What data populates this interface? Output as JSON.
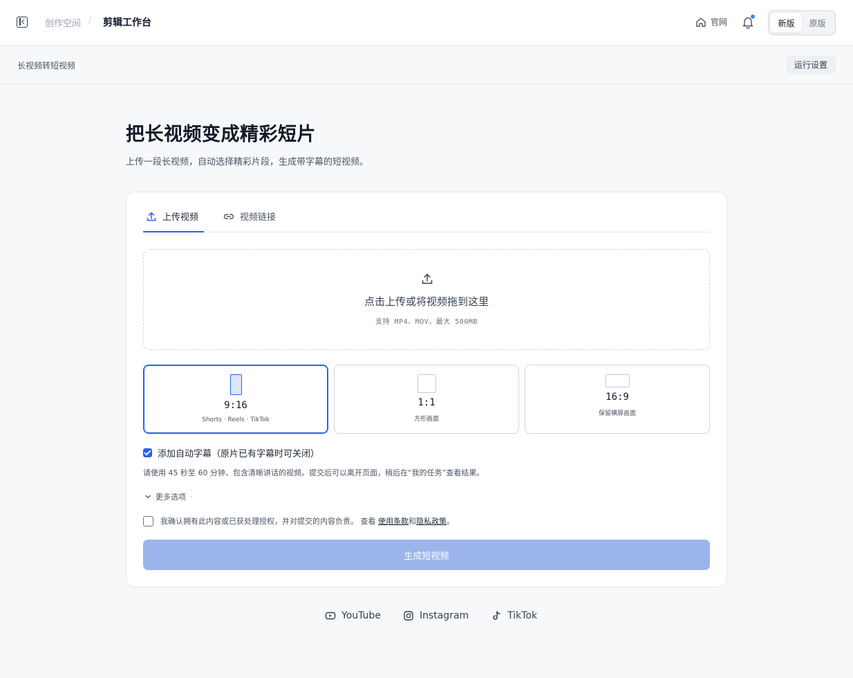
{
  "header": {
    "breadcrumb_root": "创作空间",
    "breadcrumb_sep": "/",
    "breadcrumb_current": "剪辑工作台",
    "home_label": "官网",
    "version_new": "新版",
    "version_old": "原版"
  },
  "subbar": {
    "title": "长视频转短视频",
    "run_settings": "运行设置"
  },
  "hero": {
    "title": "把长视频变成精彩短片",
    "subtitle": "上传一段长视频，自动选择精彩片段，生成带字幕的短视频。"
  },
  "tabs": [
    {
      "label": "上传视频",
      "icon": "upload-icon",
      "active": true
    },
    {
      "label": "视频链接",
      "icon": "link-icon",
      "active": false
    }
  ],
  "dropzone": {
    "title": "点击上传或将视频拖到这里",
    "subtitle": "支持 MP4、MOV，最大 500MB"
  },
  "ratios": [
    {
      "label": "9:16",
      "caption": "Shorts · Reels · TikTok",
      "selected": true
    },
    {
      "label": "1:1",
      "caption": "方形画面",
      "selected": false
    },
    {
      "label": "16:9",
      "caption": "保留横屏画面",
      "selected": false
    }
  ],
  "options": {
    "subtitle_checkbox": "添加自动字幕（原片已有字幕时可关闭）",
    "hint": "请使用 45 秒至 60 分钟、包含清晰讲话的视频。提交后可以离开页面，稍后在“我的任务”查看结果。",
    "more_options": "更多选项",
    "more_dot": "·",
    "consent_prefix": "我确认拥有此内容或已获处理授权，并对提交的内容负责。 查看 ",
    "terms": "使用条款",
    "and": "和",
    "privacy": "隐私政策",
    "consent_suffix": "。",
    "submit": "生成短视频"
  },
  "platforms": [
    {
      "label": "YouTube",
      "icon": "youtube-icon"
    },
    {
      "label": "Instagram",
      "icon": "instagram-icon"
    },
    {
      "label": "TikTok",
      "icon": "tiktok-icon"
    }
  ],
  "colors": {
    "accent": "#2563eb",
    "submit_disabled": "#9bb5ec",
    "notification_dot": "#3b82f6"
  }
}
